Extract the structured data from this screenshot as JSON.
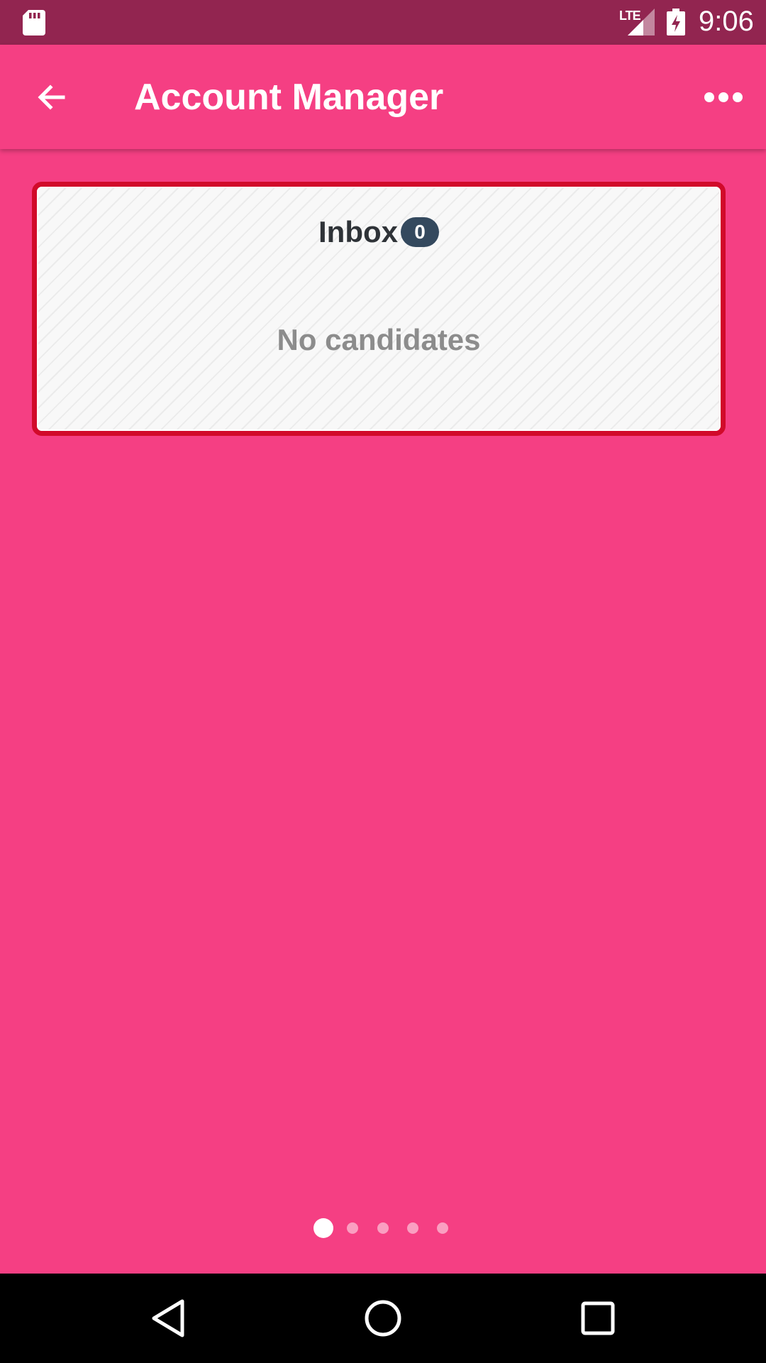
{
  "status_bar": {
    "network_label": "LTE",
    "time": "9:06",
    "icons": [
      "sd-card-icon",
      "signal-icon",
      "battery-charging-icon"
    ]
  },
  "app_bar": {
    "title": "Account Manager",
    "back_icon": "arrow-left-icon",
    "menu_icon": "more-horizontal-icon"
  },
  "inbox": {
    "label": "Inbox",
    "count": "0",
    "empty_message": "No candidates"
  },
  "pager": {
    "page_count": 5,
    "active_index": 0
  },
  "nav_bar": {
    "icons": [
      "back-triangle-icon",
      "home-circle-icon",
      "recents-square-icon"
    ]
  },
  "colors": {
    "background": "#f53f83",
    "status_bar": "#922550",
    "card_border": "#d10a2a",
    "badge": "#34495e"
  }
}
